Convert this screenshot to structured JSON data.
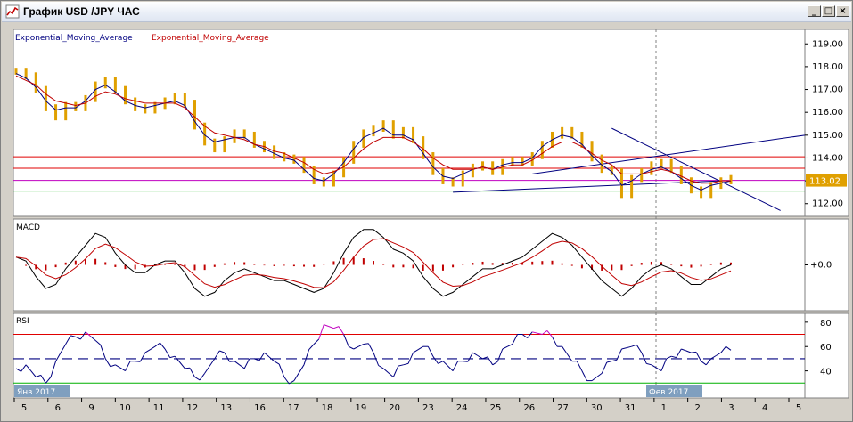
{
  "window": {
    "title": "График USD /JPY  ЧАС",
    "controls": [
      "_",
      "□",
      "×"
    ]
  },
  "legend": {
    "ema1": "Exponential_Moving_Average",
    "ema2": "Exponential_Moving_Average",
    "ema1_color": "#000080",
    "ema2_color": "#c00000"
  },
  "main_axis": {
    "ticks": [
      "119.00",
      "118.00",
      "117.00",
      "116.00",
      "115.00",
      "114.00",
      "113.00",
      "112.00"
    ],
    "current_price": "113.02",
    "current_price_color": "#e0a000"
  },
  "macd": {
    "label": "MACD",
    "axis_tick": "+0.0"
  },
  "rsi": {
    "label": "RSI",
    "axis_ticks": [
      "80",
      "60",
      "40"
    ]
  },
  "date_labels": {
    "start": "Янв 2017",
    "feb": "Фев 2017"
  },
  "x_axis": {
    "ticks": [
      "5",
      "6",
      "9",
      "10",
      "11",
      "12",
      "13",
      "16",
      "17",
      "18",
      "19",
      "20",
      "23",
      "24",
      "25",
      "26",
      "27",
      "30",
      "31",
      "1",
      "2",
      "3",
      "4",
      "5"
    ]
  },
  "chart_data": {
    "type": "line",
    "series": [
      {
        "name": "USD /JPY",
        "color": "#e0a000",
        "values": [
          117.8,
          117.6,
          117.0,
          116.2,
          115.8,
          116.3,
          116.2,
          116.6,
          117.2,
          117.4,
          117.0,
          116.5,
          116.2,
          116.1,
          116.3,
          116.5,
          116.7,
          116.4,
          115.4,
          114.7,
          114.4,
          114.8,
          115.1,
          115.0,
          114.6,
          114.4,
          114.1,
          114.0,
          113.9,
          113.5,
          113.0,
          112.9,
          113.3,
          113.9,
          114.6,
          115.1,
          115.3,
          115.5,
          115.0,
          115.2,
          114.8,
          114.1,
          113.4,
          113.0,
          112.9,
          113.3,
          113.6,
          113.7,
          113.4,
          113.8,
          113.9,
          113.8,
          114.1,
          114.6,
          115.0,
          115.2,
          115.0,
          114.6,
          114.0,
          113.5,
          113.4,
          112.4,
          113.1,
          113.4,
          113.7,
          113.8,
          113.5,
          113.0,
          112.6,
          112.4,
          112.8,
          113.0,
          113.1
        ]
      },
      {
        "name": "Exponential_Moving_Average",
        "color": "#000080",
        "values": [
          117.7,
          117.5,
          117.1,
          116.5,
          116.1,
          116.2,
          116.2,
          116.5,
          117.0,
          117.2,
          116.9,
          116.5,
          116.3,
          116.2,
          116.3,
          116.4,
          116.5,
          116.3,
          115.6,
          115.0,
          114.7,
          114.8,
          114.9,
          114.9,
          114.6,
          114.4,
          114.2,
          114.0,
          113.9,
          113.5,
          113.1,
          113.0,
          113.3,
          113.8,
          114.4,
          114.9,
          115.1,
          115.3,
          115.0,
          115.0,
          114.8,
          114.2,
          113.6,
          113.2,
          113.1,
          113.3,
          113.5,
          113.6,
          113.5,
          113.7,
          113.8,
          113.8,
          114.0,
          114.5,
          114.8,
          115.0,
          114.9,
          114.6,
          114.1,
          113.7,
          113.4,
          112.8,
          113.0,
          113.3,
          113.5,
          113.6,
          113.4,
          113.1,
          112.8,
          112.6,
          112.8,
          112.9,
          113.0
        ]
      },
      {
        "name": "Exponential_Moving_Average",
        "color": "#c00000",
        "values": [
          117.6,
          117.4,
          117.2,
          116.8,
          116.5,
          116.4,
          116.3,
          116.4,
          116.7,
          116.9,
          116.8,
          116.6,
          116.5,
          116.4,
          116.4,
          116.4,
          116.4,
          116.2,
          115.8,
          115.4,
          115.1,
          115.0,
          114.9,
          114.8,
          114.6,
          114.5,
          114.3,
          114.2,
          114.0,
          113.8,
          113.5,
          113.3,
          113.4,
          113.6,
          114.0,
          114.4,
          114.7,
          114.9,
          114.9,
          114.9,
          114.7,
          114.4,
          114.0,
          113.7,
          113.5,
          113.5,
          113.5,
          113.6,
          113.5,
          113.6,
          113.7,
          113.7,
          113.9,
          114.2,
          114.5,
          114.7,
          114.7,
          114.5,
          114.2,
          113.9,
          113.7,
          113.3,
          113.3,
          113.3,
          113.4,
          113.5,
          113.4,
          113.2,
          113.0,
          112.9,
          112.9,
          113.0,
          113.0
        ]
      }
    ],
    "horizontal_levels": [
      {
        "value": 114.05,
        "color": "#e00000"
      },
      {
        "value": 113.55,
        "color": "#e00000"
      },
      {
        "value": 113.02,
        "color": "#c000c0"
      },
      {
        "value": 112.55,
        "color": "#00b000"
      }
    ],
    "ylim": [
      111.6,
      119.4
    ],
    "rsi_levels": [
      70,
      50,
      30
    ],
    "rsi_values": [
      42,
      45,
      35,
      30,
      48,
      62,
      68,
      72,
      65,
      50,
      45,
      40,
      48,
      55,
      60,
      58,
      52,
      42,
      35,
      38,
      50,
      55,
      48,
      42,
      50,
      55,
      48,
      35,
      32,
      45,
      62,
      78,
      75,
      70,
      58,
      62,
      55,
      42,
      35,
      45,
      55,
      60,
      52,
      48,
      40,
      48,
      55,
      50,
      45,
      58,
      62,
      70,
      72,
      70,
      68,
      60,
      48,
      40,
      32,
      38,
      48,
      58,
      60,
      55,
      45,
      40,
      52,
      58,
      55,
      48,
      50,
      55,
      57
    ],
    "rsi_ylim": [
      20,
      85
    ],
    "macd_values": [
      0.2,
      0.1,
      -0.3,
      -0.6,
      -0.5,
      -0.1,
      0.2,
      0.5,
      0.8,
      0.7,
      0.3,
      0.0,
      -0.2,
      -0.2,
      0.0,
      0.1,
      0.1,
      -0.2,
      -0.6,
      -0.8,
      -0.7,
      -0.4,
      -0.2,
      -0.1,
      -0.2,
      -0.3,
      -0.4,
      -0.4,
      -0.5,
      -0.6,
      -0.7,
      -0.6,
      -0.2,
      0.3,
      0.7,
      0.9,
      0.9,
      0.7,
      0.4,
      0.3,
      0.1,
      -0.3,
      -0.6,
      -0.8,
      -0.7,
      -0.5,
      -0.3,
      -0.1,
      -0.1,
      0.0,
      0.1,
      0.2,
      0.4,
      0.6,
      0.8,
      0.7,
      0.5,
      0.2,
      -0.1,
      -0.4,
      -0.6,
      -0.8,
      -0.6,
      -0.3,
      -0.1,
      0.0,
      -0.1,
      -0.3,
      -0.5,
      -0.5,
      -0.3,
      -0.1,
      0.0
    ],
    "macd_ylim": [
      -1.1,
      1.1
    ],
    "trendlines": [
      {
        "color": "#000080"
      },
      {
        "color": "#000080"
      },
      {
        "color": "#000080"
      }
    ]
  }
}
